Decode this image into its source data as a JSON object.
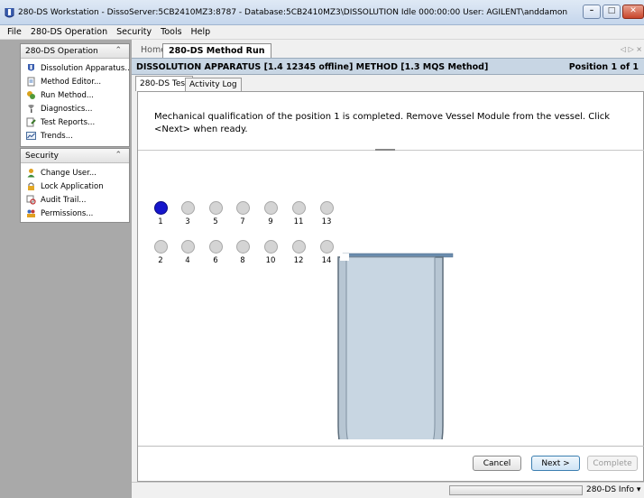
{
  "window": {
    "title": "280-DS Workstation - DissoServer:5CB2410MZ3:8787 - Database:5CB2410MZ3\\DISSOLUTION   Idle 000:00:00  User: AGILENT\\anddamon",
    "minimize_glyph": "–",
    "maximize_glyph": "□",
    "close_glyph": "✕"
  },
  "menubar": {
    "items": [
      "File",
      "280-DS Operation",
      "Security",
      "Tools",
      "Help"
    ]
  },
  "sidebar": {
    "operation_panel": {
      "title": "280-DS Operation",
      "items": [
        {
          "label": "Dissolution Apparatus...",
          "icon": "apparatus-icon"
        },
        {
          "label": "Method Editor...",
          "icon": "document-icon"
        },
        {
          "label": "Run Method...",
          "icon": "run-icon"
        },
        {
          "label": "Diagnostics...",
          "icon": "diagnostics-icon"
        },
        {
          "label": "Test Reports...",
          "icon": "report-icon"
        },
        {
          "label": "Trends...",
          "icon": "trend-icon"
        }
      ]
    },
    "security_panel": {
      "title": "Security",
      "items": [
        {
          "label": "Change User...",
          "icon": "user-icon"
        },
        {
          "label": "Lock Application",
          "icon": "lock-icon"
        },
        {
          "label": "Audit Trail...",
          "icon": "audit-icon"
        },
        {
          "label": "Permissions...",
          "icon": "permissions-icon"
        }
      ]
    },
    "collapse_glyph": "⌃"
  },
  "main": {
    "tabs": {
      "home": "Home",
      "active": "280-DS Method Run",
      "scroll_glyph": "◁ ▷ ×"
    },
    "header": {
      "left": "DISSOLUTION APPARATUS [1.4 12345 offline] METHOD [1.3 MQS Method]",
      "right": "Position 1 of 1"
    },
    "inner_tabs": [
      "280-DS Test",
      "Activity Log"
    ],
    "instruction": "Mechanical qualification of the position 1 is completed. Remove Vessel Module from the vessel. Click <Next> when ready.",
    "positions": {
      "top_row": [
        "1",
        "3",
        "5",
        "7",
        "9",
        "11",
        "13"
      ],
      "bottom_row": [
        "2",
        "4",
        "6",
        "8",
        "10",
        "12",
        "14"
      ],
      "active": "1"
    },
    "buttons": {
      "cancel": "Cancel",
      "next": "Next >",
      "complete": "Complete"
    }
  },
  "statusbar": {
    "info": "280-DS Info  ▾"
  },
  "colors": {
    "active_position": "#1515cc",
    "header_bg": "#c8d6e4",
    "sidebar_bg": "#a9a9a9",
    "vessel_fill": "#c3d3e0"
  }
}
